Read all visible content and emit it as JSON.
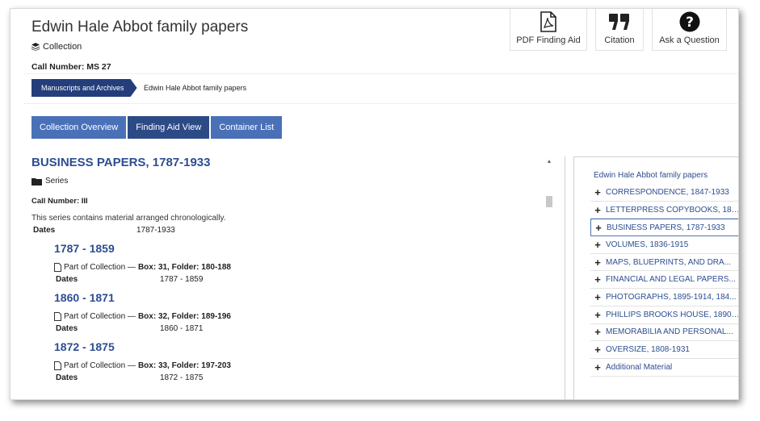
{
  "header": {
    "title": "Edwin Hale Abbot family papers",
    "record_type": "Collection",
    "call_number_label": "Call Number:",
    "call_number": "MS 27"
  },
  "tools": [
    {
      "label": "PDF Finding Aid",
      "icon": "pdf-file-icon"
    },
    {
      "label": "Citation",
      "icon": "quote-icon"
    },
    {
      "label": "Ask a Question",
      "icon": "question-circle-icon"
    }
  ],
  "breadcrumb": [
    "Manuscripts and Archives",
    "Edwin Hale Abbot family papers"
  ],
  "tabs": [
    "Collection Overview",
    "Finding Aid View",
    "Container List"
  ],
  "main": {
    "title": "BUSINESS PAPERS, 1787-1933",
    "type": "Series",
    "call_number": "Call Number: III",
    "description": "This series contains material arranged chronologically.",
    "dates_label": "Dates",
    "dates_value": "1787-1933",
    "children": [
      {
        "title": "1787 - 1859",
        "part_prefix": "Part of Collection — ",
        "location": "Box: 31, Folder: 180-188",
        "dates_label": "Dates",
        "dates": "1787 - 1859"
      },
      {
        "title": "1860 - 1871",
        "part_prefix": "Part of Collection — ",
        "location": "Box: 32, Folder: 189-196",
        "dates_label": "Dates",
        "dates": "1860 - 1871"
      },
      {
        "title": "1872 - 1875",
        "part_prefix": "Part of Collection — ",
        "location": "Box: 33, Folder: 197-203",
        "dates_label": "Dates",
        "dates": "1872 - 1875"
      }
    ]
  },
  "sidebar": {
    "top": "Edwin Hale Abbot family papers",
    "items": [
      "CORRESPONDENCE, 1847-1933",
      "LETTERPRESS COPYBOOKS, 185...",
      "BUSINESS PAPERS, 1787-1933",
      "VOLUMES, 1836-1915",
      "MAPS, BLUEPRINTS, AND DRA...",
      "FINANCIAL AND LEGAL PAPERS...",
      "PHOTOGRAPHS, 1895-1914, 184...",
      "PHILLIPS BROOKS HOUSE, 1890-...",
      "MEMORABILIA AND PERSONAL...",
      "OVERSIZE, 1808-1931",
      "Additional Material"
    ],
    "current_index": 2
  },
  "colors": {
    "accent": "#4a71b8",
    "accent_dark": "#233e7a",
    "link": "#2d4d92"
  }
}
